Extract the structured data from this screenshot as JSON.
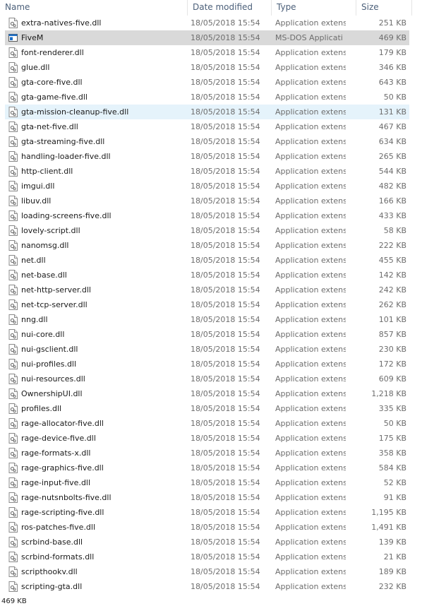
{
  "columns": {
    "name": "Name",
    "date": "Date modified",
    "type": "Type",
    "size": "Size"
  },
  "files": [
    {
      "name": "extra-natives-five.dll",
      "date": "18/05/2018 15:54",
      "type": "Application extens",
      "size": "251 KB",
      "icon": "dll-file-icon"
    },
    {
      "name": "FiveM",
      "date": "18/05/2018 15:54",
      "type": "MS-DOS Applicati",
      "size": "469 KB",
      "icon": "executable-file-icon",
      "state": "selected"
    },
    {
      "name": "font-renderer.dll",
      "date": "18/05/2018 15:54",
      "type": "Application extens",
      "size": "179 KB",
      "icon": "dll-file-icon"
    },
    {
      "name": "glue.dll",
      "date": "18/05/2018 15:54",
      "type": "Application extens",
      "size": "346 KB",
      "icon": "dll-file-icon"
    },
    {
      "name": "gta-core-five.dll",
      "date": "18/05/2018 15:54",
      "type": "Application extens",
      "size": "643 KB",
      "icon": "dll-file-icon"
    },
    {
      "name": "gta-game-five.dll",
      "date": "18/05/2018 15:54",
      "type": "Application extens",
      "size": "50 KB",
      "icon": "dll-file-icon"
    },
    {
      "name": "gta-mission-cleanup-five.dll",
      "date": "18/05/2018 15:54",
      "type": "Application extens",
      "size": "131 KB",
      "icon": "dll-file-icon",
      "state": "hover"
    },
    {
      "name": "gta-net-five.dll",
      "date": "18/05/2018 15:54",
      "type": "Application extens",
      "size": "467 KB",
      "icon": "dll-file-icon"
    },
    {
      "name": "gta-streaming-five.dll",
      "date": "18/05/2018 15:54",
      "type": "Application extens",
      "size": "634 KB",
      "icon": "dll-file-icon"
    },
    {
      "name": "handling-loader-five.dll",
      "date": "18/05/2018 15:54",
      "type": "Application extens",
      "size": "265 KB",
      "icon": "dll-file-icon"
    },
    {
      "name": "http-client.dll",
      "date": "18/05/2018 15:54",
      "type": "Application extens",
      "size": "544 KB",
      "icon": "dll-file-icon"
    },
    {
      "name": "imgui.dll",
      "date": "18/05/2018 15:54",
      "type": "Application extens",
      "size": "482 KB",
      "icon": "dll-file-icon"
    },
    {
      "name": "libuv.dll",
      "date": "18/05/2018 15:54",
      "type": "Application extens",
      "size": "166 KB",
      "icon": "dll-file-icon"
    },
    {
      "name": "loading-screens-five.dll",
      "date": "18/05/2018 15:54",
      "type": "Application extens",
      "size": "433 KB",
      "icon": "dll-file-icon"
    },
    {
      "name": "lovely-script.dll",
      "date": "18/05/2018 15:54",
      "type": "Application extens",
      "size": "58 KB",
      "icon": "dll-file-icon"
    },
    {
      "name": "nanomsg.dll",
      "date": "18/05/2018 15:54",
      "type": "Application extens",
      "size": "222 KB",
      "icon": "dll-file-icon"
    },
    {
      "name": "net.dll",
      "date": "18/05/2018 15:54",
      "type": "Application extens",
      "size": "455 KB",
      "icon": "dll-file-icon"
    },
    {
      "name": "net-base.dll",
      "date": "18/05/2018 15:54",
      "type": "Application extens",
      "size": "142 KB",
      "icon": "dll-file-icon"
    },
    {
      "name": "net-http-server.dll",
      "date": "18/05/2018 15:54",
      "type": "Application extens",
      "size": "242 KB",
      "icon": "dll-file-icon"
    },
    {
      "name": "net-tcp-server.dll",
      "date": "18/05/2018 15:54",
      "type": "Application extens",
      "size": "262 KB",
      "icon": "dll-file-icon"
    },
    {
      "name": "nng.dll",
      "date": "18/05/2018 15:54",
      "type": "Application extens",
      "size": "101 KB",
      "icon": "dll-file-icon"
    },
    {
      "name": "nui-core.dll",
      "date": "18/05/2018 15:54",
      "type": "Application extens",
      "size": "857 KB",
      "icon": "dll-file-icon"
    },
    {
      "name": "nui-gsclient.dll",
      "date": "18/05/2018 15:54",
      "type": "Application extens",
      "size": "230 KB",
      "icon": "dll-file-icon"
    },
    {
      "name": "nui-profiles.dll",
      "date": "18/05/2018 15:54",
      "type": "Application extens",
      "size": "172 KB",
      "icon": "dll-file-icon"
    },
    {
      "name": "nui-resources.dll",
      "date": "18/05/2018 15:54",
      "type": "Application extens",
      "size": "609 KB",
      "icon": "dll-file-icon"
    },
    {
      "name": "OwnershipUI.dll",
      "date": "18/05/2018 15:54",
      "type": "Application extens",
      "size": "1,218 KB",
      "icon": "dll-file-icon"
    },
    {
      "name": "profiles.dll",
      "date": "18/05/2018 15:54",
      "type": "Application extens",
      "size": "335 KB",
      "icon": "dll-file-icon"
    },
    {
      "name": "rage-allocator-five.dll",
      "date": "18/05/2018 15:54",
      "type": "Application extens",
      "size": "50 KB",
      "icon": "dll-file-icon"
    },
    {
      "name": "rage-device-five.dll",
      "date": "18/05/2018 15:54",
      "type": "Application extens",
      "size": "175 KB",
      "icon": "dll-file-icon"
    },
    {
      "name": "rage-formats-x.dll",
      "date": "18/05/2018 15:54",
      "type": "Application extens",
      "size": "358 KB",
      "icon": "dll-file-icon"
    },
    {
      "name": "rage-graphics-five.dll",
      "date": "18/05/2018 15:54",
      "type": "Application extens",
      "size": "584 KB",
      "icon": "dll-file-icon"
    },
    {
      "name": "rage-input-five.dll",
      "date": "18/05/2018 15:54",
      "type": "Application extens",
      "size": "52 KB",
      "icon": "dll-file-icon"
    },
    {
      "name": "rage-nutsnbolts-five.dll",
      "date": "18/05/2018 15:54",
      "type": "Application extens",
      "size": "91 KB",
      "icon": "dll-file-icon"
    },
    {
      "name": "rage-scripting-five.dll",
      "date": "18/05/2018 15:54",
      "type": "Application extens",
      "size": "1,195 KB",
      "icon": "dll-file-icon"
    },
    {
      "name": "ros-patches-five.dll",
      "date": "18/05/2018 15:54",
      "type": "Application extens",
      "size": "1,491 KB",
      "icon": "dll-file-icon"
    },
    {
      "name": "scrbind-base.dll",
      "date": "18/05/2018 15:54",
      "type": "Application extens",
      "size": "139 KB",
      "icon": "dll-file-icon"
    },
    {
      "name": "scrbind-formats.dll",
      "date": "18/05/2018 15:54",
      "type": "Application extens",
      "size": "21 KB",
      "icon": "dll-file-icon"
    },
    {
      "name": "scripthookv.dll",
      "date": "18/05/2018 15:54",
      "type": "Application extens",
      "size": "189 KB",
      "icon": "dll-file-icon"
    },
    {
      "name": "scripting-gta.dll",
      "date": "18/05/2018 15:54",
      "type": "Application extens",
      "size": "232 KB",
      "icon": "dll-file-icon"
    }
  ],
  "status": {
    "selection_size": "469 KB"
  },
  "colors": {
    "selected_row": "#d9d9d9",
    "hover_row": "#e5f3fb",
    "header_text": "#4c607a",
    "detail_text": "#6d6d6d",
    "exe_icon_blue": "#1f6fc5"
  }
}
